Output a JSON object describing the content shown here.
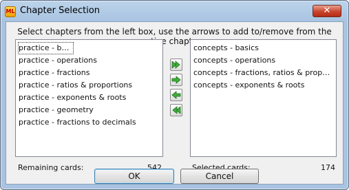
{
  "window": {
    "title": "Chapter Selection",
    "icon_label": "ML",
    "close_symbol": "✕"
  },
  "instructions": "Select chapters from the left box, use the arrows to add to/remove from the active chapters.",
  "left_list": {
    "items": [
      "practice - basics",
      "practice - operations",
      "practice - fractions",
      "practice - ratios & proportions",
      "practice - exponents & roots",
      "practice - geometry",
      "practice - fractions to decimals"
    ],
    "focused_index": 0
  },
  "right_list": {
    "items": [
      "concepts - basics",
      "concepts - operations",
      "concepts - fractions, ratios & proporti...",
      "concepts - exponents & roots"
    ]
  },
  "arrows": [
    {
      "name": "add-all",
      "icon": "double-right-arrow-icon"
    },
    {
      "name": "add",
      "icon": "right-arrow-icon"
    },
    {
      "name": "remove",
      "icon": "left-arrow-icon"
    },
    {
      "name": "remove-all",
      "icon": "double-left-arrow-icon"
    }
  ],
  "remaining": {
    "label": "Remaining cards:",
    "value": "542"
  },
  "selected": {
    "label": "Selected cards:",
    "value": "174"
  },
  "buttons": {
    "ok": "OK",
    "cancel": "Cancel"
  },
  "colors": {
    "arrow_green": "#3fae3a",
    "title_bar": "#a9c4e2",
    "close_red": "#c8452e"
  }
}
